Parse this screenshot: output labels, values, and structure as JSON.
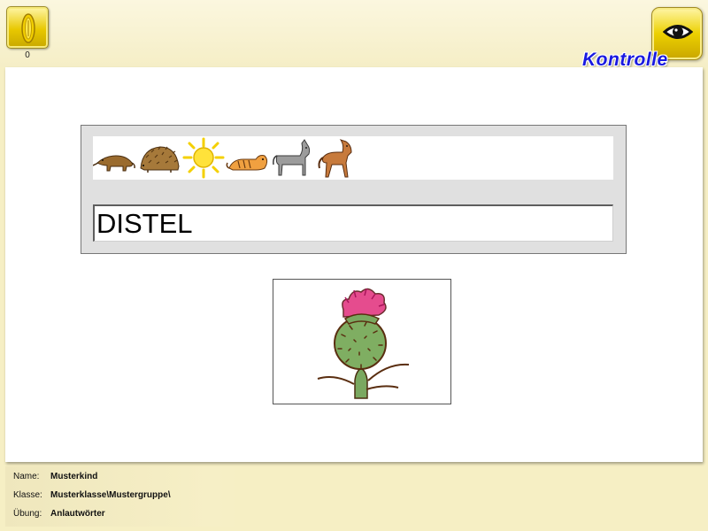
{
  "toolbar": {
    "coin_count": "0",
    "kontrolle_label": "Kontrolle",
    "coin_icon": "coin-icon",
    "eye_icon": "eye-icon"
  },
  "exercise": {
    "picture_strip": [
      "anteater",
      "hedgehog",
      "sun",
      "tiger",
      "donkey",
      "horse"
    ],
    "answer_value": "DISTEL",
    "target_picture": "thistle"
  },
  "info": {
    "name_label": "Name:",
    "name_value": "Musterkind",
    "class_label": "Klasse:",
    "class_value": "Musterklasse\\Mustergruppe\\",
    "exercise_label": "Übung:",
    "exercise_value": "Anlautwörter"
  },
  "colors": {
    "accent_blue": "#1919e0",
    "button_gold": "#ecd000",
    "background": "#f6efc4"
  }
}
